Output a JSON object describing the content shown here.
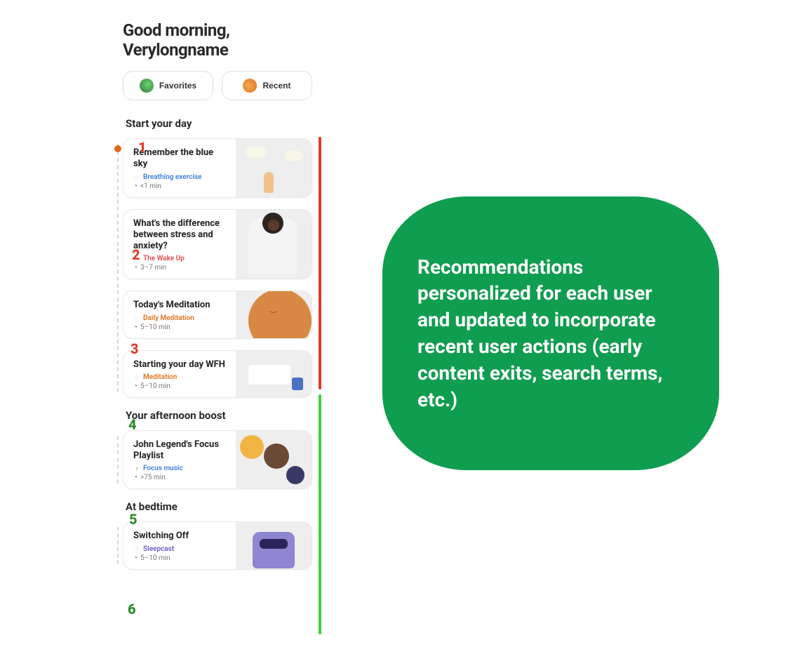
{
  "greeting_line1": "Good morning,",
  "greeting_line2": "Verylongname",
  "pills": {
    "favorites": "Favorites",
    "recent": "Recent"
  },
  "sections": {
    "start": "Start your day",
    "afternoon": "Your afternoon boost",
    "bedtime": "At bedtime"
  },
  "cards": {
    "sky": {
      "title": "Remember the blue sky",
      "tag": "Breathing exercise",
      "tag_class": "tag-blue",
      "duration": "<1 min"
    },
    "stress": {
      "title": "What's the difference between stress and anxiety?",
      "tag": "The Wake Up",
      "tag_class": "tag-red",
      "duration": "3–7 min"
    },
    "med": {
      "title": "Today's Meditation",
      "tag": "Daily Meditation",
      "tag_class": "tag-orange",
      "duration": "5–10 min"
    },
    "wfh": {
      "title": "Starting your day WFH",
      "tag": "Meditation",
      "tag_class": "tag-orange",
      "duration": "5–10 min"
    },
    "focus": {
      "title": "John Legend's Focus Playlist",
      "tag": "Focus music",
      "tag_class": "tag-blue",
      "duration": ">75 min"
    },
    "sleep": {
      "title": "Switching Off",
      "tag": "Sleepcast",
      "tag_class": "tag-purple",
      "duration": "5–10 min"
    }
  },
  "annotations": {
    "numbers": [
      "1",
      "2",
      "3",
      "4",
      "5",
      "6"
    ],
    "colors": {
      "red": "#e03a2a",
      "green": "#3ecf3e",
      "dark_green": "#2e8b2e"
    }
  },
  "callout_text": "Recommendations personalized for each user and updated to incorporate recent user actions (early content exits, search terms, etc.)"
}
